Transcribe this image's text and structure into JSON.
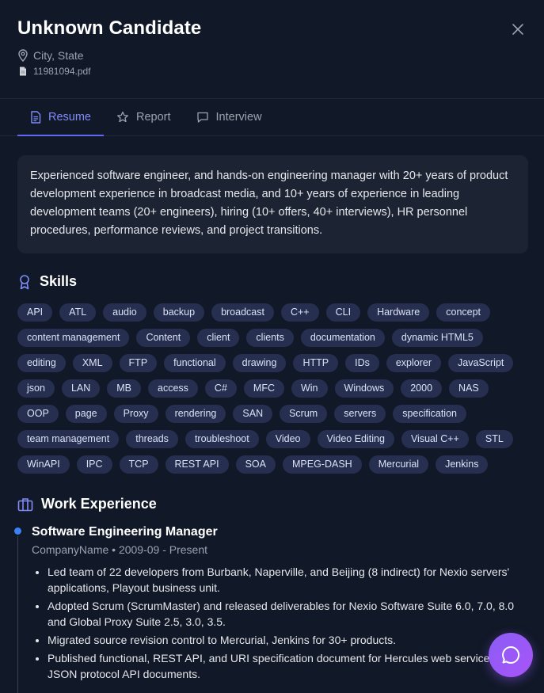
{
  "header": {
    "name": "Unknown Candidate",
    "location": "City, State",
    "file": "11981094.pdf"
  },
  "tabs": [
    {
      "label": "Resume",
      "icon": "document-icon",
      "active": true
    },
    {
      "label": "Report",
      "icon": "star-icon",
      "active": false
    },
    {
      "label": "Interview",
      "icon": "chat-icon",
      "active": false
    }
  ],
  "summary": "Experienced software engineer, and hands-on engineering manager with 20+ years of product development experience in broadcast media, and 10+ years of experience in leading development teams (20+ engineers), hiring (10+ offers, 40+ interviews), HR personnel procedures, performance reviews, and project transitions.",
  "skills": {
    "title": "Skills",
    "items": [
      "API",
      "ATL",
      "audio",
      "backup",
      "broadcast",
      "C++",
      "CLI",
      "Hardware",
      "concept",
      "content management",
      "Content",
      "client",
      "clients",
      "documentation",
      "dynamic HTML5",
      "editing",
      "XML",
      "FTP",
      "functional",
      "drawing",
      "HTTP",
      "IDs",
      "explorer",
      "JavaScript",
      "json",
      "LAN",
      "MB",
      "access",
      "C#",
      "MFC",
      "Win",
      "Windows",
      "2000",
      "NAS",
      "OOP",
      "page",
      "Proxy",
      "rendering",
      "SAN",
      "Scrum",
      "servers",
      "specification",
      "team management",
      "threads",
      "troubleshoot",
      "Video",
      "Video Editing",
      "Visual C++",
      "STL",
      "WinAPI",
      "IPC",
      "TCP",
      "REST API",
      "SOA",
      "MPEG-DASH",
      "Mercurial",
      "Jenkins"
    ]
  },
  "experience": {
    "title": "Work Experience",
    "jobs": [
      {
        "title": "Software Engineering Manager",
        "company": "CompanyName",
        "separator": "•",
        "dates": "2009-09 - Present",
        "bullets": [
          "Led team of 22 developers from Burbank, Naperville, and Beijing (8 indirect) for Nexio servers' applications, Playout business unit.",
          "Adopted Scrum (ScrumMaster) and released deliverables for Nexio Software Suite 6.0, 7.0, 8.0 and Global Proxy Suite 2.5, 3.0, 3.5.",
          "Migrated source revision control to Mercurial, Jenkins for 30+ products.",
          "Published functional, REST API, and URI specification document for Hercules web service and 10 JSON protocol API documents."
        ]
      }
    ]
  },
  "colors": {
    "background": "#111827",
    "accent": "#6366f1",
    "chip": "#262f50",
    "fab": "#8b5cf6"
  }
}
